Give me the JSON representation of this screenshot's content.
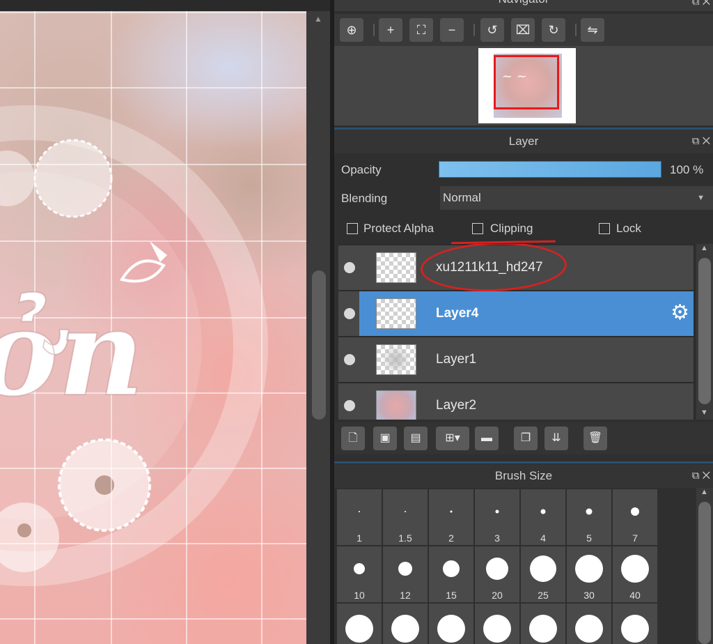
{
  "colors": {
    "accent_blue": "#4a8fd4",
    "annotation_red": "#d42222",
    "panel_bg": "#2f2f2f"
  },
  "navigator": {
    "title": "Navigator",
    "corner_icons": [
      "maximize-icon",
      "close-icon"
    ],
    "toolbar": [
      {
        "name": "zoom-actual-icon",
        "glyph": "⊕"
      },
      {
        "name": "zoom-in-icon",
        "glyph": "+"
      },
      {
        "name": "fit-screen-icon",
        "glyph": "⛶"
      },
      {
        "name": "zoom-out-icon",
        "glyph": "−"
      },
      {
        "name": "rotate-left-icon",
        "glyph": "↺"
      },
      {
        "name": "reset-view-icon",
        "glyph": "⌧"
      },
      {
        "name": "rotate-right-icon",
        "glyph": "↻"
      },
      {
        "name": "flip-horizontal-icon",
        "glyph": "⇋"
      }
    ]
  },
  "layer_panel": {
    "title": "Layer",
    "opacity_label": "Opacity",
    "opacity_value": "100 %",
    "opacity_fraction": 1.0,
    "blending_label": "Blending",
    "blending_value": "Normal",
    "checkboxes": {
      "protect_alpha": "Protect Alpha",
      "clipping": "Clipping",
      "lock": "Lock"
    },
    "layers": [
      {
        "name": "xu1211k11_hd247",
        "selected": false,
        "thumb": "transparent"
      },
      {
        "name": "Layer4",
        "selected": true,
        "thumb": "transparent"
      },
      {
        "name": "Layer1",
        "selected": false,
        "thumb": "blur"
      },
      {
        "name": "Layer2",
        "selected": false,
        "thumb": "picture"
      }
    ],
    "toolbar": [
      {
        "name": "new-layer-icon",
        "glyph": "🗋"
      },
      {
        "name": "new-halftone-layer-icon",
        "glyph": "▣"
      },
      {
        "name": "new-1bit-layer-icon",
        "glyph": "▤"
      },
      {
        "name": "add-layer-dropdown-icon",
        "glyph": "⊞▾"
      },
      {
        "name": "folder-icon",
        "glyph": "▬"
      },
      {
        "name": "duplicate-layer-icon",
        "glyph": "❐"
      },
      {
        "name": "merge-layer-icon",
        "glyph": "⇊"
      },
      {
        "name": "trash-icon",
        "glyph": "🗑"
      }
    ]
  },
  "brush_size": {
    "title": "Brush Size",
    "sizes": [
      "1",
      "1.5",
      "2",
      "3",
      "4",
      "5",
      "7",
      "10",
      "12",
      "15",
      "20",
      "25",
      "30",
      "40",
      "",
      "",
      "",
      "",
      "",
      "",
      ""
    ]
  },
  "canvas": {
    "artwork_text": "ởn"
  }
}
